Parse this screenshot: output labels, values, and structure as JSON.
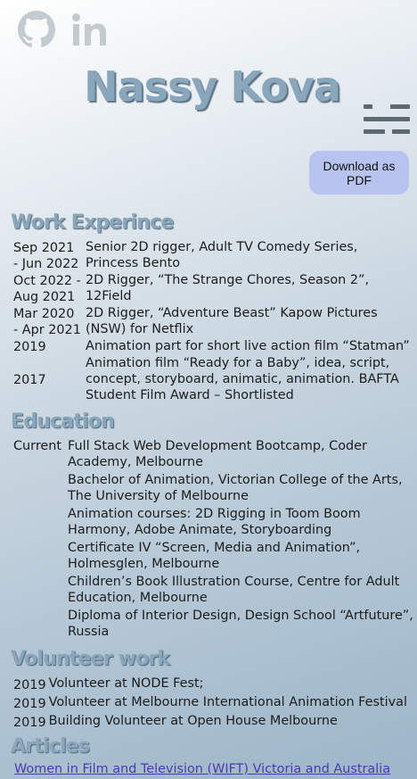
{
  "header": {
    "name": "Nassy Kova",
    "pdf_button": "Download as PDF",
    "icons": [
      "github-icon",
      "linkedin-icon",
      "menu-icon"
    ]
  },
  "work": {
    "heading": "Work Experince",
    "rows": [
      {
        "date": "Sep 2021 - Jun 2022",
        "text": "Senior 2D rigger, Adult TV Comedy Series, Princess Bento"
      },
      {
        "date": "Oct 2022 - Aug 2021",
        "text": "2D Rigger, “The Strange Chores, Season 2”, 12Field"
      },
      {
        "date": "Mar 2020 - Apr 2021",
        "text": "2D Rigger, “Adventure Beast” Kapow Pictures (NSW) for Netflix"
      },
      {
        "date": "2019",
        "text": "Animation part for short live action film “Statman”"
      },
      {
        "date": "2017",
        "text": "Animation film “Ready for a Baby”, idea, script, concept, storyboard, animatic, animation. BAFTA Student Film Award – Shortlisted"
      }
    ]
  },
  "education": {
    "heading": "Education",
    "rows": [
      {
        "date": "Current",
        "text": "Full Stack Web Development Bootcamp, Coder Academy, Melbourne"
      },
      {
        "date": "",
        "text": "Bachelor of Animation, Victorian College of the Arts, The University of Melbourne"
      },
      {
        "date": "",
        "text": "Animation courses: 2D Rigging in Toom Boom Harmony, Adobe Animate, Storyboarding"
      },
      {
        "date": "",
        "text": "Certificate IV “Screen, Media and Animation”, Holmesglen, Melbourne"
      },
      {
        "date": "",
        "text": "Children’s Book Illustration Course, Centre for Adult Education, Melbourne"
      },
      {
        "date": "",
        "text": "Diploma of Interior Design, Design School “Artfuture”, Russia"
      }
    ]
  },
  "volunteer": {
    "heading": "Volunteer work",
    "rows": [
      {
        "date": "2019",
        "text": "Volunteer at NODE Fest;"
      },
      {
        "date": "2019",
        "text": "Volunteer at Melbourne International Animation Festival"
      },
      {
        "date": "2019",
        "text": "Building Volunteer at Open House Melbourne"
      }
    ]
  },
  "articles": {
    "heading": "Articles",
    "link": "Women in Film and Television (WIFT) Victoria and Australia"
  }
}
